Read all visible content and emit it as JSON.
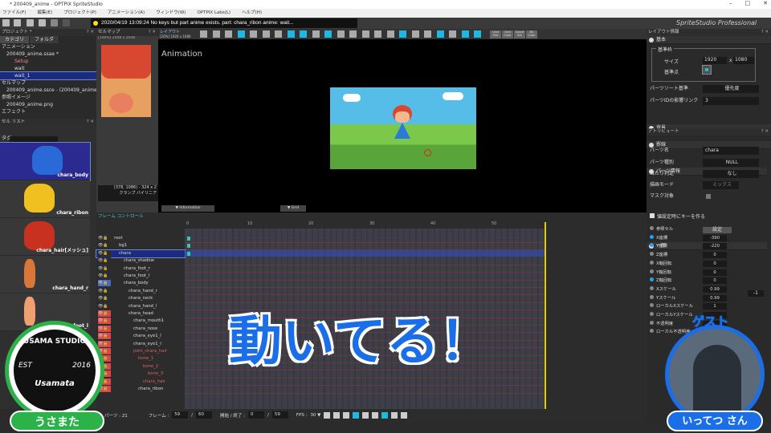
{
  "window": {
    "title": "* 200409_anime - OPTPIX SpriteStudio",
    "controls": [
      "–",
      "□",
      "✕"
    ]
  },
  "menu": [
    "ファイル(F)",
    "編集(E)",
    "プロジェクト(P)",
    "アニメーション(A)",
    "ウィンドウ(W)",
    "OPTPIX Labs(L)",
    "ヘルプ(H)"
  ],
  "status": "2020/04/19 13:09:24   No keys but part anime exists. part: chara_ribon anime: wait...",
  "brand": "SpriteStudio Professional",
  "project": {
    "title": "プロジェクト *",
    "tabs": [
      "カテゴリ",
      "フォルダ"
    ],
    "items": [
      "アニメーション",
      "200409_anime.ssae *",
      "Setup",
      "wait",
      "wait_1",
      "セルマップ",
      "200409_anime.ssce - (200409_anime.png)",
      "参照イメージ",
      "200409_anime.png",
      "エフェクト"
    ]
  },
  "cellmap": {
    "title": "セルマップ",
    "info": "[100%] 2048 x 2048",
    "coords": "(378, 1086) - 324 x 2",
    "filter": "クランプ バイリニア"
  },
  "layout": {
    "title": "レイアウト",
    "info": "[20%] 1920 x 1080",
    "mode": "Animation",
    "btn_info": "▼ Information",
    "btn_grid": "▼ Grid",
    "grid_buttons": [
      "Grid Size",
      "Grid Color",
      "Coord Set",
      "BG Color"
    ]
  },
  "celllist": {
    "title": "セル リスト",
    "tag_label": "タグ",
    "cells": [
      "chara_body",
      "chara_ribon",
      "chara_hair[メッシュ]",
      "chara_hand_r",
      "chara_foot_l"
    ]
  },
  "timeline": {
    "title": "フレーム コントロール",
    "ticks": [
      "0",
      "10",
      "20",
      "30",
      "40",
      "50"
    ],
    "parts": [
      {
        "name": "root",
        "d": 0,
        "c": ""
      },
      {
        "name": "bg1",
        "d": 1,
        "c": ""
      },
      {
        "name": "chara",
        "d": 1,
        "c": "sel"
      },
      {
        "name": "chara_shadow",
        "d": 2,
        "c": ""
      },
      {
        "name": "chara_foot_r",
        "d": 2,
        "c": ""
      },
      {
        "name": "chara_foot_l",
        "d": 2,
        "c": ""
      },
      {
        "name": "chara_body",
        "d": 2,
        "c": "blue"
      },
      {
        "name": "chara_hand_r",
        "d": 3,
        "c": ""
      },
      {
        "name": "chara_neck",
        "d": 3,
        "c": ""
      },
      {
        "name": "chara_hand_l",
        "d": 3,
        "c": ""
      },
      {
        "name": "chara_head",
        "d": 3,
        "c": "red"
      },
      {
        "name": "chara_mouth1",
        "d": 4,
        "c": "red"
      },
      {
        "name": "chara_nose",
        "d": 4,
        "c": "red"
      },
      {
        "name": "chara_eye1_l",
        "d": 4,
        "c": "red"
      },
      {
        "name": "chara_eye1_r",
        "d": 4,
        "c": "red"
      },
      {
        "name": "joint_chara_hair",
        "d": 4,
        "c": "red"
      },
      {
        "name": "bone_1",
        "d": 5,
        "c": "red"
      },
      {
        "name": "bone_2",
        "d": 6,
        "c": "red"
      },
      {
        "name": "bone_3",
        "d": 7,
        "c": "red"
      },
      {
        "name": "chara_hair",
        "d": 6,
        "c": "red"
      },
      {
        "name": "chara_ribon",
        "d": 5,
        "c": "red"
      }
    ]
  },
  "bottom": {
    "parts": "パーツ : 21",
    "frame_label": "フレーム :",
    "frame": "59",
    "frame_total": "60",
    "range_label": "開始 / 終了 :",
    "start": "0",
    "end": "59",
    "fps_label": "FPS :",
    "fps": "30 ▼",
    "slash": "/"
  },
  "layoutinfo": {
    "title": "レイアウト情報",
    "basic": "基本",
    "frame": "基準枠",
    "size_label": "サイズ",
    "w": "1920",
    "x": "x",
    "h": "1080",
    "origin_label": "基準点",
    "sort_label": "パーツソート基準",
    "sort": "優先度",
    "link_label": "パーツIDの影響リンク",
    "link": "3",
    "bg": "背景",
    "grid": "罫線"
  },
  "attr": {
    "title": "アトリビュート",
    "part_info": "パーツ情報",
    "name_label": "パーツ名",
    "name": "chara",
    "type_label": "パーツ種別",
    "type": "NULL",
    "hit_label": "当たり判定",
    "hit": "なし",
    "blend_label": "描画モード",
    "blend": "ミックス",
    "mask_label": "マスク対象",
    "general": "一般",
    "keycheck": "値設定時にキーを作る",
    "set_btn": "設定",
    "rows": [
      {
        "l": "参照セル",
        "v": "",
        "b": false
      },
      {
        "l": "X座標",
        "v": "-390",
        "b": true
      },
      {
        "l": "Y座標",
        "v": "-220",
        "b": true
      },
      {
        "l": "Z座標",
        "v": "0",
        "b": false
      },
      {
        "l": "X軸回転",
        "v": "0",
        "b": false
      },
      {
        "l": "Y軸回転",
        "v": "0",
        "b": false
      },
      {
        "l": "Z軸回転",
        "v": "0",
        "b": true
      },
      {
        "l": "Xスケール",
        "v": "0.99",
        "b": false
      },
      {
        "l": "Yスケール",
        "v": "0.99",
        "b": false
      },
      {
        "l": "ローカルXスケール",
        "v": "1",
        "b": false
      },
      {
        "l": "ローカルYスケール",
        "v": "",
        "b": false
      },
      {
        "l": "不透明度",
        "v": "",
        "b": false
      },
      {
        "l": "ローカル不透明度",
        "v": "",
        "b": false
      }
    ],
    "extra": "-1"
  },
  "overlay": {
    "caption": "動いてる！",
    "logo_top": "USAMA STUDIO",
    "logo_est": "EST",
    "logo_year": "2016",
    "logo_name": "Usamata",
    "host": "うさまた",
    "guest_label": "ゲスト",
    "guest": "いってつ さん"
  },
  "colors": {
    "accent": "#1fb8e0",
    "host": "#2bb34a",
    "guest": "#1a6ee8",
    "playhead": "#e0d000"
  }
}
